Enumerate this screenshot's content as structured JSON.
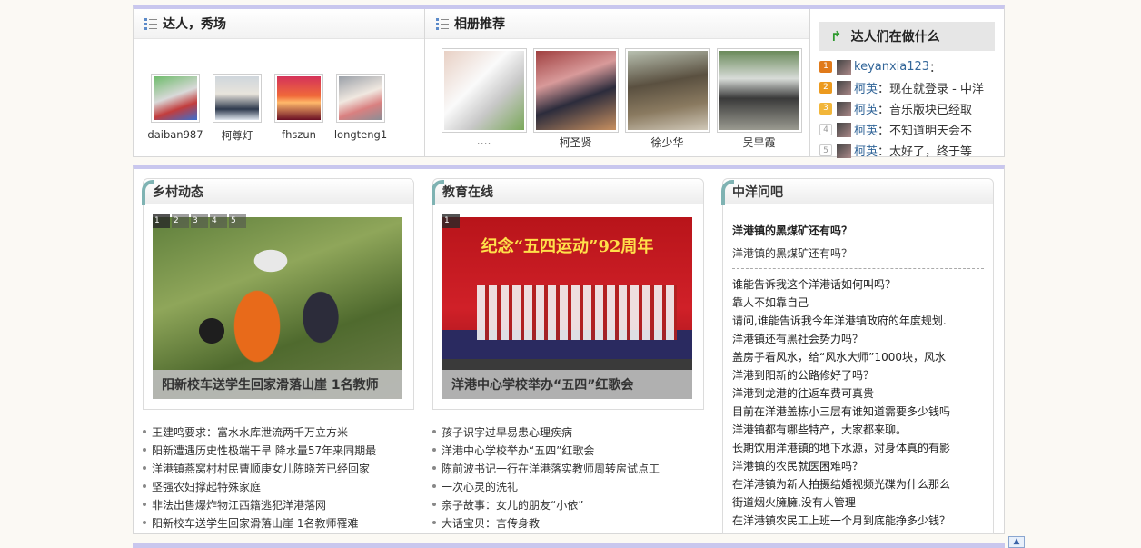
{
  "talent": {
    "title": "达人，秀场",
    "users": [
      {
        "name": "daiban987",
        "gradient": "linear-gradient(160deg,#6dbb6a 0%,#d9d9d9 45%,#c23d3d 70%,#3a6fcf 100%)"
      },
      {
        "name": "柯尊灯",
        "gradient": "linear-gradient(180deg,#cfd6dc 0%,#e8e4dc 40%,#2e3a4e 75%,#dfe6ee 100%)"
      },
      {
        "name": "fhszun",
        "gradient": "linear-gradient(180deg,#d4325a 0%,#f06a3a 45%,#ffb86a 60%,#6a1024 100%)"
      },
      {
        "name": "longteng1",
        "gradient": "linear-gradient(160deg,#9aa0a8 0%,#f0e8e0 45%,#d98080 70%,#8a8e96 100%)"
      }
    ]
  },
  "albums": {
    "title": "相册推荐",
    "items": [
      {
        "name": "….",
        "gradient": "linear-gradient(135deg,#e8d0c4 0%,#fafafa 40%,#c8c8c8 65%,#7aa85a 100%)"
      },
      {
        "name": "柯圣贤",
        "gradient": "linear-gradient(160deg,#a04040 0%,#d89a9a 35%,#2c2c3c 60%,#c89060 100%)"
      },
      {
        "name": "徐少华",
        "gradient": "linear-gradient(170deg,#b8c0b0 0%,#5a5040 40%,#8a7a60 70%,#d0c8b8 100%)"
      },
      {
        "name": "吴早霞",
        "gradient": "linear-gradient(180deg,#6a8a5a 0%,#d8dcd8 35%,#3a3a3a 60%,#9a9a90 100%)"
      }
    ]
  },
  "activity": {
    "title": "达人们在做什么",
    "items": [
      {
        "rank": "1",
        "name": "keyanxia123",
        "text": "："
      },
      {
        "rank": "2",
        "name": "柯英",
        "text": "：现在就登录 - 中洋"
      },
      {
        "rank": "3",
        "name": "柯英",
        "text": "：音乐版块已经取"
      },
      {
        "rank": "4",
        "name": "柯英",
        "text": "：不知道明天会不"
      },
      {
        "rank": "5",
        "name": "柯英",
        "text": "：太好了，终于等"
      }
    ]
  },
  "village": {
    "title": "乡村动态",
    "slide_numbers": [
      "1",
      "2",
      "3",
      "4",
      "5"
    ],
    "caption": "阳新校车送学生回家滑落山崖 1名教师",
    "news": [
      "王建鸣要求：富水水库泄流两千万立方米",
      "阳新遭遇历史性极端干旱 降水量57年来同期最",
      "洋港镇燕窝村村民曹顺庚女儿陈晓芳已经回家",
      "坚强农妇撑起特殊家庭",
      "非法出售爆炸物江西籍逃犯洋港落网",
      "阳新校车送学生回家滑落山崖 1名教师罹难"
    ]
  },
  "education": {
    "title": "教育在线",
    "slide_numbers": [
      "1"
    ],
    "banner": "纪念“五四运动”92周年",
    "caption": "洋港中心学校举办“五四”红歌会",
    "news": [
      "孩子识字过早易患心理疾病",
      "洋港中心学校举办“五四”红歌会",
      "陈前波书记一行在洋港落实教师周转房试点工",
      "一次心灵的洗礼",
      "亲子故事：女儿的朋友“小依”",
      "大话宝贝：言传身教"
    ]
  },
  "qa": {
    "title": "中洋问吧",
    "top_question": "洋港镇的黑煤矿还有吗？",
    "top_answer": "洋港镇的黑煤矿还有吗？",
    "questions": [
      "谁能告诉我这个洋港话如何叫吗？",
      "靠人不如靠自己",
      "请问,谁能告诉我今年洋港镇政府的年度规划.",
      "洋港镇还有黑社会势力吗？",
      "盖房子看风水，给“风水大师”1000块，风水",
      "洋港到阳新的公路修好了吗？",
      "洋港到龙港的往返车费可真贵",
      "目前在洋港盖栋小三层有谁知道需要多少钱吗",
      "洋港镇都有哪些特产，大家都来聊。",
      "长期饮用洋港镇的地下水源，对身体真的有影",
      "洋港镇的农民就医困难吗？",
      "在洋港镇为新人拍摄结婚视频光碟为什么那么",
      "街道烟火臃臃,没有人管理",
      "在洋港镇农民工上班一个月到底能挣多少钱？"
    ]
  },
  "back_top": "▲"
}
